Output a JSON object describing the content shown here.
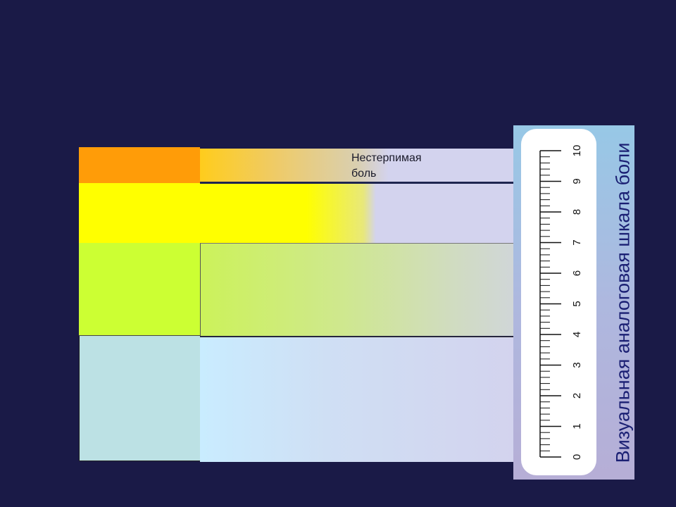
{
  "band_label": {
    "line1": "Нестерпимая",
    "line2": "боль"
  },
  "scale": {
    "title": "Визуальная аналоговая шкала боли",
    "min": 0,
    "max": 10,
    "minor_ticks_per_unit": 5,
    "tick_labels": [
      "0",
      "1",
      "2",
      "3",
      "4",
      "5",
      "6",
      "7",
      "8",
      "9",
      "10"
    ]
  },
  "colors": {
    "background": "#1a1a47",
    "orange": "#ff9c08",
    "yellow": "#ffff00",
    "lime": "#ccff33",
    "light_blue": "#bce1e4",
    "lavender": "#d3d3ee",
    "title_text": "#1a1f73"
  }
}
